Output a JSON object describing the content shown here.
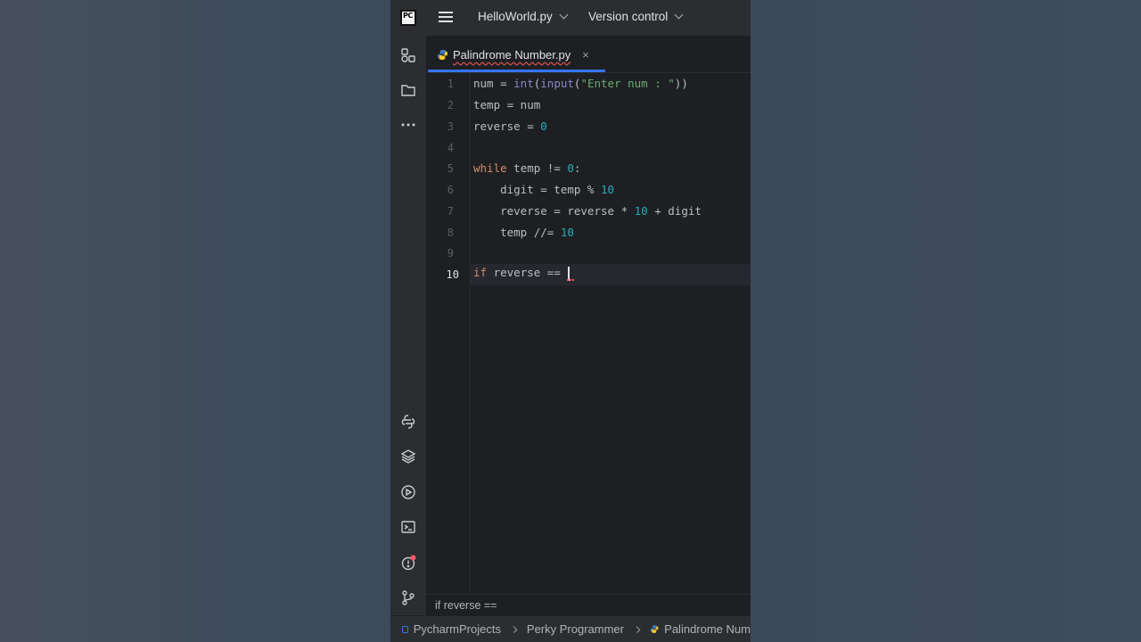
{
  "titlebar": {
    "project_file": "HelloWorld.py",
    "vcs_menu": "Version control",
    "logo_text": "PC"
  },
  "tab": {
    "label": "Palindrome Number.py",
    "close_glyph": "×"
  },
  "editor": {
    "line_numbers": [
      "1",
      "2",
      "3",
      "4",
      "5",
      "6",
      "7",
      "8",
      "9",
      "10"
    ],
    "current_line": "10"
  },
  "hint": "if reverse ==",
  "breadcrumbs": [
    "PycharmProjects",
    "Perky Programmer",
    "Palindrome Num"
  ],
  "left_toolbar_icons": [
    "structure-icon",
    "project-folder-icon",
    "more-icon",
    "python-console-icon",
    "layers-icon",
    "run-icon",
    "terminal-icon",
    "problems-icon",
    "git-icon"
  ],
  "colors": {
    "accent": "#3574f0",
    "background": "#1e1f22",
    "panel": "#2b2d30"
  }
}
